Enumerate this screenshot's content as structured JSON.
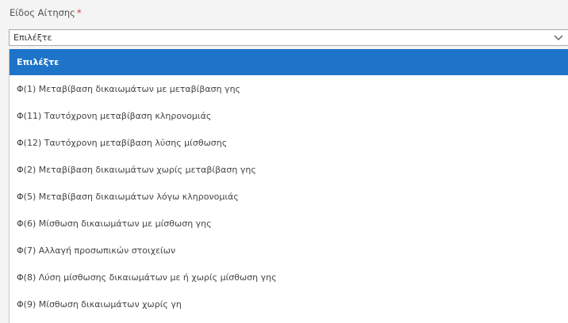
{
  "field": {
    "label": "Είδος Αίτησης",
    "required_mark": "*",
    "selected_value": "Επιλέξτε"
  },
  "icons": {
    "dropdown_toggle": "chevron-down-icon"
  },
  "colors": {
    "required": "#d32f2f",
    "highlight": "#1e74c9"
  },
  "dropdown": {
    "options": [
      "Επιλέξτε",
      "Φ(1) Μεταβίβαση δικαιωμάτων με μεταβίβαση γης",
      "Φ(11) Ταυτόχρονη μεταβίβαση κληρονομιάς",
      "Φ(12) Ταυτόχρονη μεταβίβαση λύσης μίσθωσης",
      "Φ(2) Μεταβίβαση δικαιωμάτων χωρίς μεταβίβαση γης",
      "Φ(5) Μεταβίβαση δικαιωμάτων λόγω κληρονομιάς",
      "Φ(6) Μίσθωση δικαιωμάτων με μίσθωση γης",
      "Φ(7) Αλλαγή προσωπικών στοιχείων",
      "Φ(8) Λύση μίσθωσης δικαιωμάτων με ή χωρίς μίσθωση γης",
      "Φ(9) Μίσθωση δικαιωμάτων χωρίς γη"
    ]
  }
}
